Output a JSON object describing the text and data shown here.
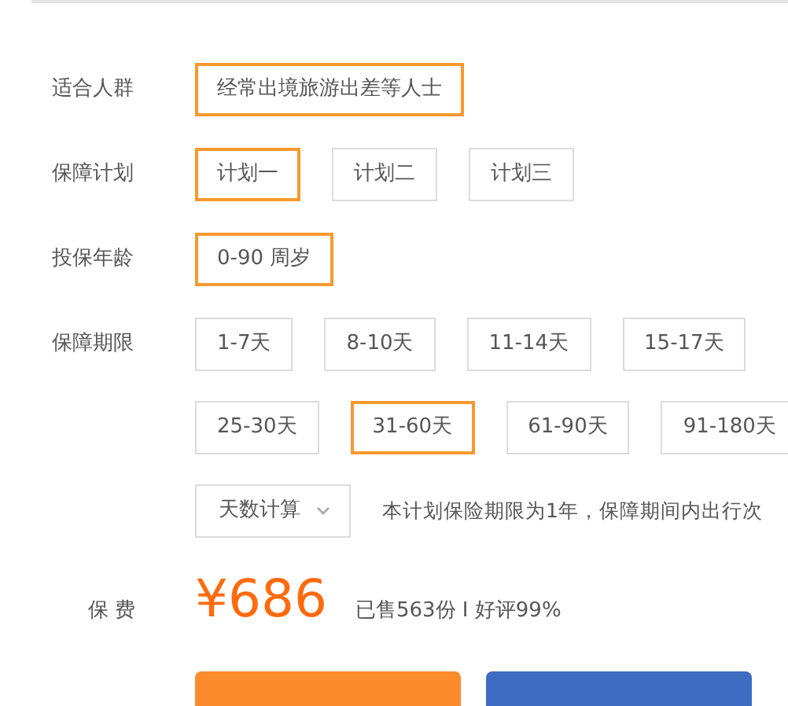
{
  "fields": [
    {
      "label": "适合人群",
      "rows": [
        [
          {
            "text": "经常出境旅游出差等人士",
            "selected": true
          }
        ]
      ]
    },
    {
      "label": "保障计划",
      "rows": [
        [
          {
            "text": "计划一",
            "selected": true
          },
          {
            "text": "计划二",
            "selected": false
          },
          {
            "text": "计划三",
            "selected": false
          }
        ]
      ]
    },
    {
      "label": "投保年龄",
      "rows": [
        [
          {
            "text": "0-90 周岁",
            "selected": true
          }
        ]
      ]
    },
    {
      "label": "保障期限",
      "rows": [
        [
          {
            "text": "1-7天",
            "selected": false
          },
          {
            "text": "8-10天",
            "selected": false
          },
          {
            "text": "11-14天",
            "selected": false
          },
          {
            "text": "15-17天",
            "selected": false
          }
        ],
        [
          {
            "text": "25-30天",
            "selected": false
          },
          {
            "text": "31-60天",
            "selected": true
          },
          {
            "text": "61-90天",
            "selected": false
          },
          {
            "text": "91-180天",
            "selected": false
          }
        ]
      ],
      "dropdown": {
        "value": "天数计算"
      },
      "note": "本计划保险期限为1年，保障期间内出行次"
    }
  ],
  "price": {
    "label": "保 费",
    "amount": "¥686",
    "stats": "已售563份 I 好评99%"
  },
  "action_buttons": [
    {
      "color": "#fb8c2c"
    },
    {
      "color": "#3e6cc2"
    }
  ]
}
